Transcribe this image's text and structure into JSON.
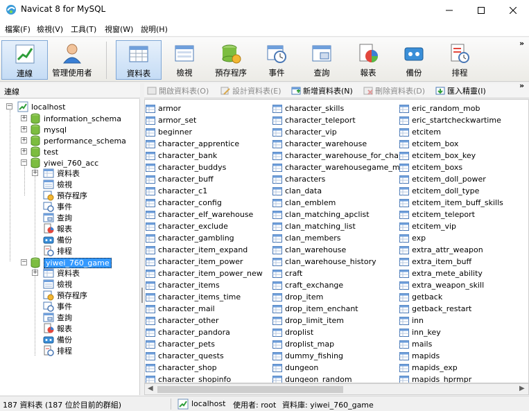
{
  "window": {
    "title": "Navicat 8 for MySQL"
  },
  "menu": [
    "檔案(F)",
    "檢視(V)",
    "工具(T)",
    "視窗(W)",
    "說明(H)"
  ],
  "toolbar": {
    "connection": "連線",
    "user_manager": "管理使用者",
    "tables": "資料表",
    "views": "檢視",
    "procedures": "預存程序",
    "events": "事件",
    "queries": "查詢",
    "reports": "報表",
    "backup": "備份",
    "schedule": "排程",
    "more": "»"
  },
  "left_panel": {
    "header": "連線"
  },
  "tree": {
    "connection": "localhost",
    "databases": [
      "information_schema",
      "mysql",
      "performance_schema",
      "test",
      "yiwei_760_acc",
      "yiwei_760_game"
    ],
    "acc_children": [
      "資料表",
      "檢視",
      "預存程序",
      "事件",
      "查詢",
      "報表",
      "備份",
      "排程"
    ],
    "game_children": [
      "資料表",
      "檢視",
      "預存程序",
      "事件",
      "查詢",
      "報表",
      "備份",
      "排程"
    ]
  },
  "actions": {
    "open": "開啟資料表(O)",
    "design": "設計資料表(E)",
    "new": "新增資料表(N)",
    "delete": "刪除資料表(D)",
    "import": "匯入精靈(I)",
    "more": "»"
  },
  "tables": {
    "col1": [
      "armor",
      "armor_set",
      "beginner",
      "character_apprentice",
      "character_bank",
      "character_buddys",
      "character_buff",
      "character_c1",
      "character_config",
      "character_elf_warehouse",
      "character_exclude",
      "character_gambling",
      "character_item_expand",
      "character_item_power",
      "character_item_power_new",
      "character_items",
      "character_items_time",
      "character_mail",
      "character_other",
      "character_pandora",
      "character_pets",
      "character_quests",
      "character_shop",
      "character_shopinfo"
    ],
    "col2": [
      "character_skills",
      "character_teleport",
      "character_vip",
      "character_warehouse",
      "character_warehouse_for_cha",
      "character_warehousegame_mall",
      "characters",
      "clan_data",
      "clan_emblem",
      "clan_matching_apclist",
      "clan_matching_list",
      "clan_members",
      "clan_warehouse",
      "clan_warehouse_history",
      "craft",
      "craft_exchange",
      "drop_item",
      "drop_item_enchant",
      "drop_limit_item",
      "droplist",
      "droplist_map",
      "dummy_fishing",
      "dungeon",
      "dungeon_random"
    ],
    "col3": [
      "eric_random_mob",
      "eric_startcheckwartime",
      "etcitem",
      "etcitem_box",
      "etcitem_box_key",
      "etcitem_boxs",
      "etcitem_doll_power",
      "etcitem_doll_type",
      "etcitem_item_buff_skills",
      "etcitem_teleport",
      "etcitem_vip",
      "exp",
      "extra_attr_weapon",
      "extra_item_buff",
      "extra_mete_ability",
      "extra_weapon_skill",
      "getback",
      "getback_restart",
      "inn",
      "inn_key",
      "mails",
      "mapids",
      "mapids_exp",
      "mapids_hprmpr"
    ]
  },
  "status": {
    "count": "187 資料表 (187 位於目前的群組)",
    "connection": "localhost",
    "user": "使用者: root",
    "database": "資料庫: yiwei_760_game"
  }
}
